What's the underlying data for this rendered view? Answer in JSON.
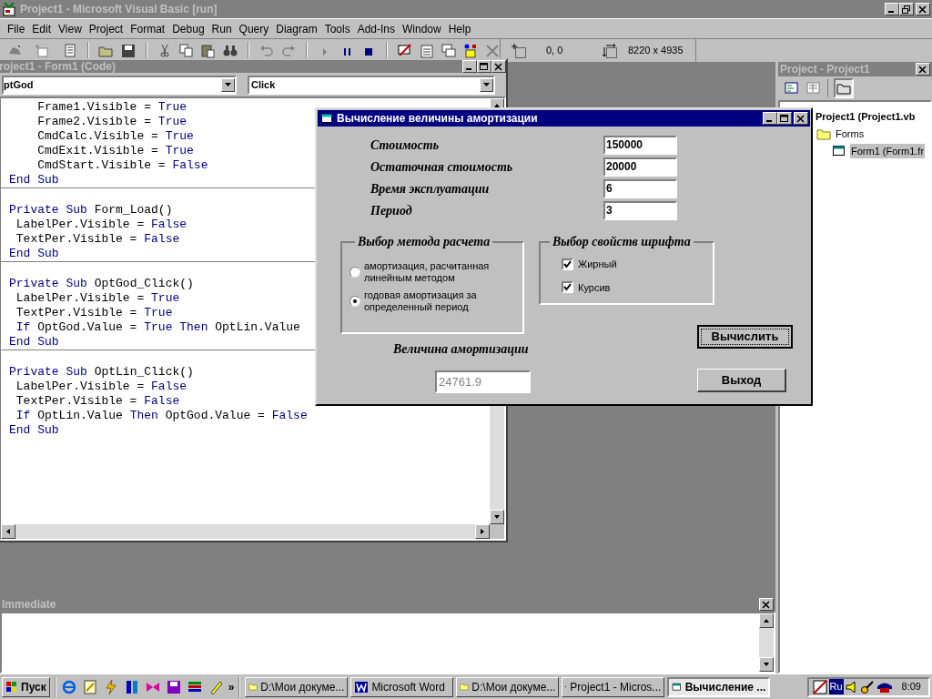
{
  "window": {
    "title": "Project1 - Microsoft Visual Basic [run]"
  },
  "menu": [
    "File",
    "Edit",
    "View",
    "Project",
    "Format",
    "Debug",
    "Run",
    "Query",
    "Diagram",
    "Tools",
    "Add-Ins",
    "Window",
    "Help"
  ],
  "toolbar": {
    "position": "0, 0",
    "size": "8220 x 4935"
  },
  "code_window": {
    "title": "roject1 - Form1 (Code)",
    "object": "ptGod",
    "procedure": "Click",
    "procedures": [
      {
        "lines": [
          [
            {
              "text": "    Frame1.Visible = ",
              "kind": "code"
            },
            {
              "text": "True",
              "kind": "keyword"
            }
          ],
          [
            {
              "text": "    Frame2.Visible = ",
              "kind": "code"
            },
            {
              "text": "True",
              "kind": "keyword"
            }
          ],
          [
            {
              "text": "    CmdCalc.Visible = ",
              "kind": "code"
            },
            {
              "text": "True",
              "kind": "keyword"
            }
          ],
          [
            {
              "text": "    CmdExit.Visible = ",
              "kind": "code"
            },
            {
              "text": "True",
              "kind": "keyword"
            }
          ],
          [
            {
              "text": "    CmdStart.Visible = ",
              "kind": "code"
            },
            {
              "text": "False",
              "kind": "keyword"
            }
          ],
          [
            {
              "text": "End Sub",
              "kind": "keyword"
            }
          ]
        ]
      },
      {
        "lines": [
          [
            {
              "text": "Private Sub",
              "kind": "keyword"
            },
            {
              "text": " Form_Load()",
              "kind": "code"
            }
          ],
          [
            {
              "text": " LabelPer.Visible = ",
              "kind": "code"
            },
            {
              "text": "False",
              "kind": "keyword"
            }
          ],
          [
            {
              "text": " TextPer.Visible = ",
              "kind": "code"
            },
            {
              "text": "False",
              "kind": "keyword"
            }
          ],
          [
            {
              "text": "End Sub",
              "kind": "keyword"
            }
          ]
        ]
      },
      {
        "lines": [
          [
            {
              "text": "Private Sub",
              "kind": "keyword"
            },
            {
              "text": " OptGod_Click()",
              "kind": "code"
            }
          ],
          [
            {
              "text": " LabelPer.Visible = ",
              "kind": "code"
            },
            {
              "text": "True",
              "kind": "keyword"
            }
          ],
          [
            {
              "text": " TextPer.Visible = ",
              "kind": "code"
            },
            {
              "text": "True",
              "kind": "keyword"
            }
          ],
          [
            {
              "text": " If",
              "kind": "keyword"
            },
            {
              "text": " OptGod.Value = ",
              "kind": "code"
            },
            {
              "text": "True Then",
              "kind": "keyword"
            },
            {
              "text": " OptLin.Value",
              "kind": "code"
            }
          ],
          [
            {
              "text": "End Sub",
              "kind": "keyword"
            }
          ]
        ]
      },
      {
        "lines": [
          [
            {
              "text": "Private Sub",
              "kind": "keyword"
            },
            {
              "text": " OptLin_Click()",
              "kind": "code"
            }
          ],
          [
            {
              "text": " LabelPer.Visible = ",
              "kind": "code"
            },
            {
              "text": "False",
              "kind": "keyword"
            }
          ],
          [
            {
              "text": " TextPer.Visible = ",
              "kind": "code"
            },
            {
              "text": "False",
              "kind": "keyword"
            }
          ],
          [
            {
              "text": " If",
              "kind": "keyword"
            },
            {
              "text": " OptLin.Value ",
              "kind": "code"
            },
            {
              "text": "Then",
              "kind": "keyword"
            },
            {
              "text": " OptGod.Value = ",
              "kind": "code"
            },
            {
              "text": "False",
              "kind": "keyword"
            }
          ],
          [
            {
              "text": "End Sub",
              "kind": "keyword"
            }
          ]
        ]
      }
    ]
  },
  "immediate": {
    "title": "Immediate"
  },
  "project": {
    "title": "Project - Project1",
    "tree": [
      {
        "label": "Project1 (Project1.vb",
        "kind": "project",
        "selected": false,
        "children": [
          {
            "label": "Forms",
            "kind": "folder",
            "selected": false,
            "children": [
              {
                "label": "Form1 (Form1.fr",
                "kind": "form",
                "selected": true
              }
            ]
          }
        ]
      }
    ]
  },
  "dialog": {
    "title": "Вычисление величины амортизации",
    "fields": [
      {
        "label": "Стоимость",
        "value": "150000"
      },
      {
        "label": "Остаточная стоимость",
        "value": "20000"
      },
      {
        "label": "Время эксплуатации",
        "value": "6"
      },
      {
        "label": "Период",
        "value": "3"
      }
    ],
    "method_frame": {
      "title": "Выбор метода расчета",
      "options": [
        {
          "label": "амортизация, расчитанная линейным методом",
          "selected": false
        },
        {
          "label": "годовая амортизация за определенный период",
          "selected": true
        }
      ]
    },
    "font_frame": {
      "title": "Выбор свойств шрифта",
      "options": [
        {
          "label": "Жирный",
          "checked": true
        },
        {
          "label": "Курсив",
          "checked": true
        }
      ]
    },
    "result_label": "Величина амортизации",
    "result": {
      "value": "24761.9",
      "disabled": true
    },
    "buttons": [
      {
        "label": "Вычислить",
        "default": true
      },
      {
        "label": "Выход",
        "default": false
      }
    ]
  },
  "taskbar": {
    "start": "Пуск",
    "more": "»",
    "tasks": [
      {
        "label": "D:\\Мои докуме...",
        "kind": "folder",
        "selected": false
      },
      {
        "label": "Microsoft Word",
        "kind": "word",
        "selected": false
      },
      {
        "label": "D:\\Мои докуме...",
        "kind": "folder",
        "selected": false
      },
      {
        "label": "Project1 - Micros...",
        "kind": "vb",
        "selected": false
      },
      {
        "label": "Вычисление ...",
        "kind": "form",
        "selected": true
      }
    ],
    "language": "Ru",
    "clock": "8:09"
  }
}
